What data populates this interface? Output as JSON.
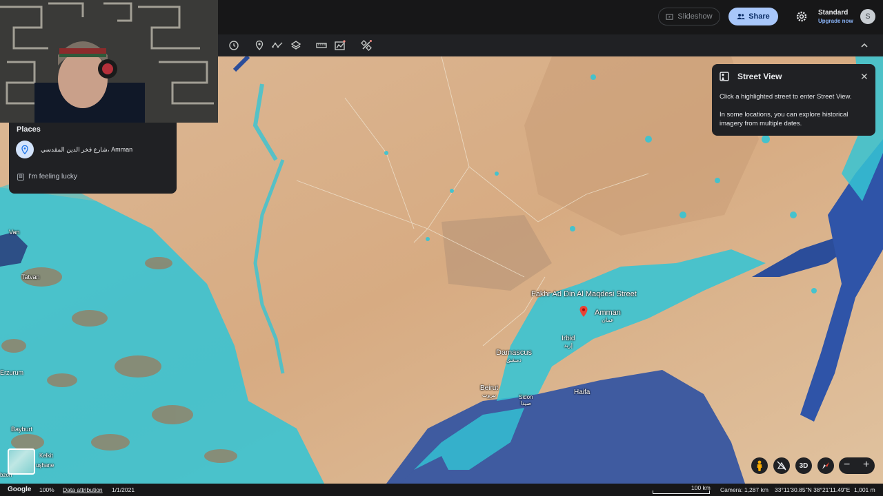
{
  "topbar": {
    "slideshow_label": "Slideshow",
    "share_label": "Share",
    "plan_name": "Standard",
    "upgrade_label": "Upgrade now",
    "avatar_initial": "S"
  },
  "toolbar": {
    "icons": [
      "history-icon",
      "placemark-icon",
      "path-icon",
      "layers-icon",
      "ruler-icon",
      "chart-icon",
      "satellite-icon",
      "chevron-up-icon"
    ]
  },
  "places": {
    "title": "Places",
    "item": "شارع فخر الدين المقدسي، Amman",
    "lucky_label": "I'm feeling lucky"
  },
  "street_view": {
    "title": "Street View",
    "text1": "Click a highlighted street to enter Street View.",
    "text2": "In some locations, you can explore historical imagery from multiple dates."
  },
  "map_labels": {
    "street": "Fakhr Ad Din Al Maqdesi Street",
    "amman": "Amman",
    "amman_ar": "عمان",
    "irbid": "Irbid",
    "irbid_ar": "إربد",
    "damascus": "Damascus",
    "damascus_ar": "دمشق",
    "beirut": "Beirut",
    "beirut_ar": "بيروت",
    "sidon": "Sidon",
    "sidon_ar": "صيدا",
    "haifa": "Haifa",
    "van": "Van",
    "tatvan": "Tatvan",
    "erzurum": "Erzurum",
    "bayburt": "Bayburt",
    "kelkit": "Kelkit",
    "gumushane": "uşhane",
    "bozon": "bzon"
  },
  "controls": {
    "threed_label": "3D",
    "zoom_out": "−",
    "zoom_in": "+"
  },
  "status": {
    "google": "Google",
    "zoom": "100%",
    "attribution": "Data attribution",
    "date": "1/1/2021",
    "scale": "100 km",
    "camera": "Camera: 1,287 km",
    "coords": "33°11'30.85\"N 38°21'11.49\"E",
    "altitude": "1,001 m"
  },
  "colors": {
    "accent": "#a8c7fa",
    "water_overlay": "#35c4d4",
    "sea": "#3f5ba0",
    "desert": "#d9b38c"
  }
}
